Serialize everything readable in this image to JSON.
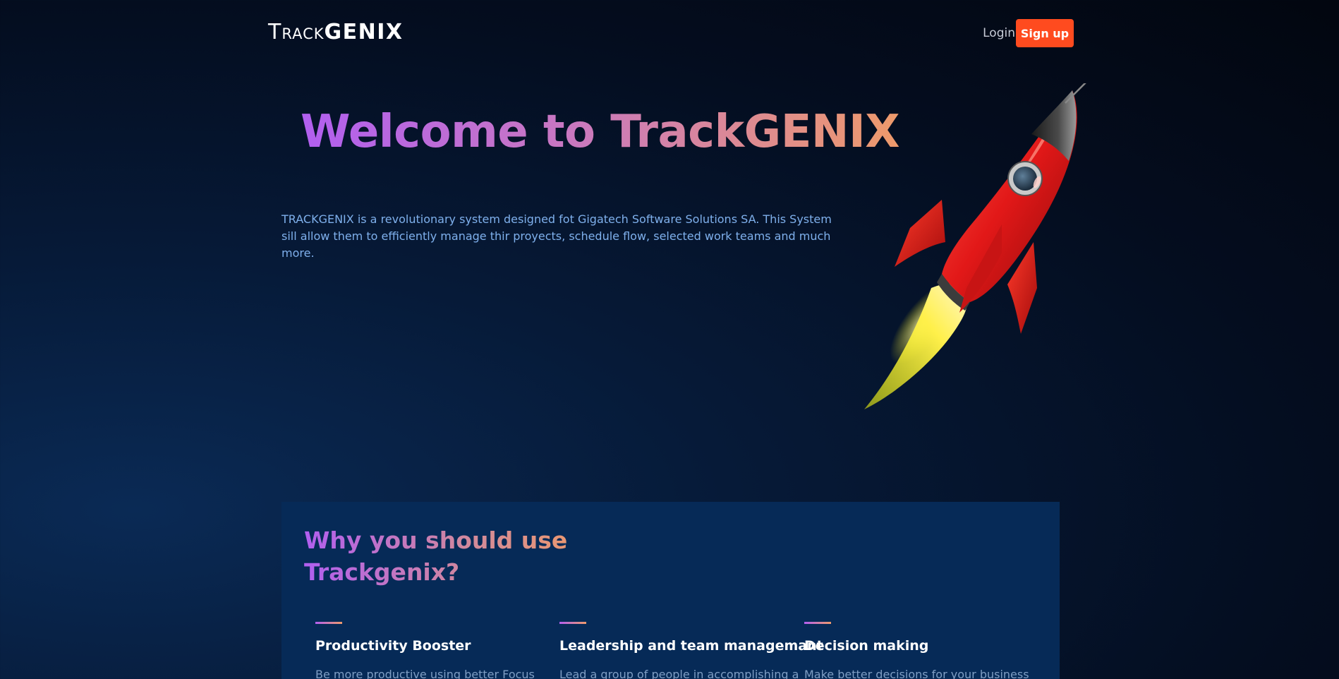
{
  "header": {
    "logo": {
      "t1": "T",
      "t2": "RACK",
      "t3": "GENIX"
    },
    "login_label": "Login",
    "signup_label": "Sign up"
  },
  "hero": {
    "title": "Welcome to TrackGENIX",
    "description": "TRACKGENIX is a revolutionary system designed fot Gigatech Software Solutions SA. This System sill allow them to efficiently manage thir proyects, schedule flow, selected work teams and much more.",
    "image": "rocket-illustration"
  },
  "why": {
    "title": "Why you should use Trackgenix?",
    "features": [
      {
        "title": "Productivity Booster",
        "text": "Be more productive using better Focus"
      },
      {
        "title": "Leadership and team managemant",
        "text": "Lead a group of people in accomplishing a"
      },
      {
        "title": "Decision making",
        "text": "Make better decisions for your business"
      }
    ]
  },
  "colors": {
    "accent": "#ff4b1f",
    "gradient_start": "#b15ff0",
    "gradient_end": "#ee9a6b",
    "card_bg": "#062a57"
  }
}
